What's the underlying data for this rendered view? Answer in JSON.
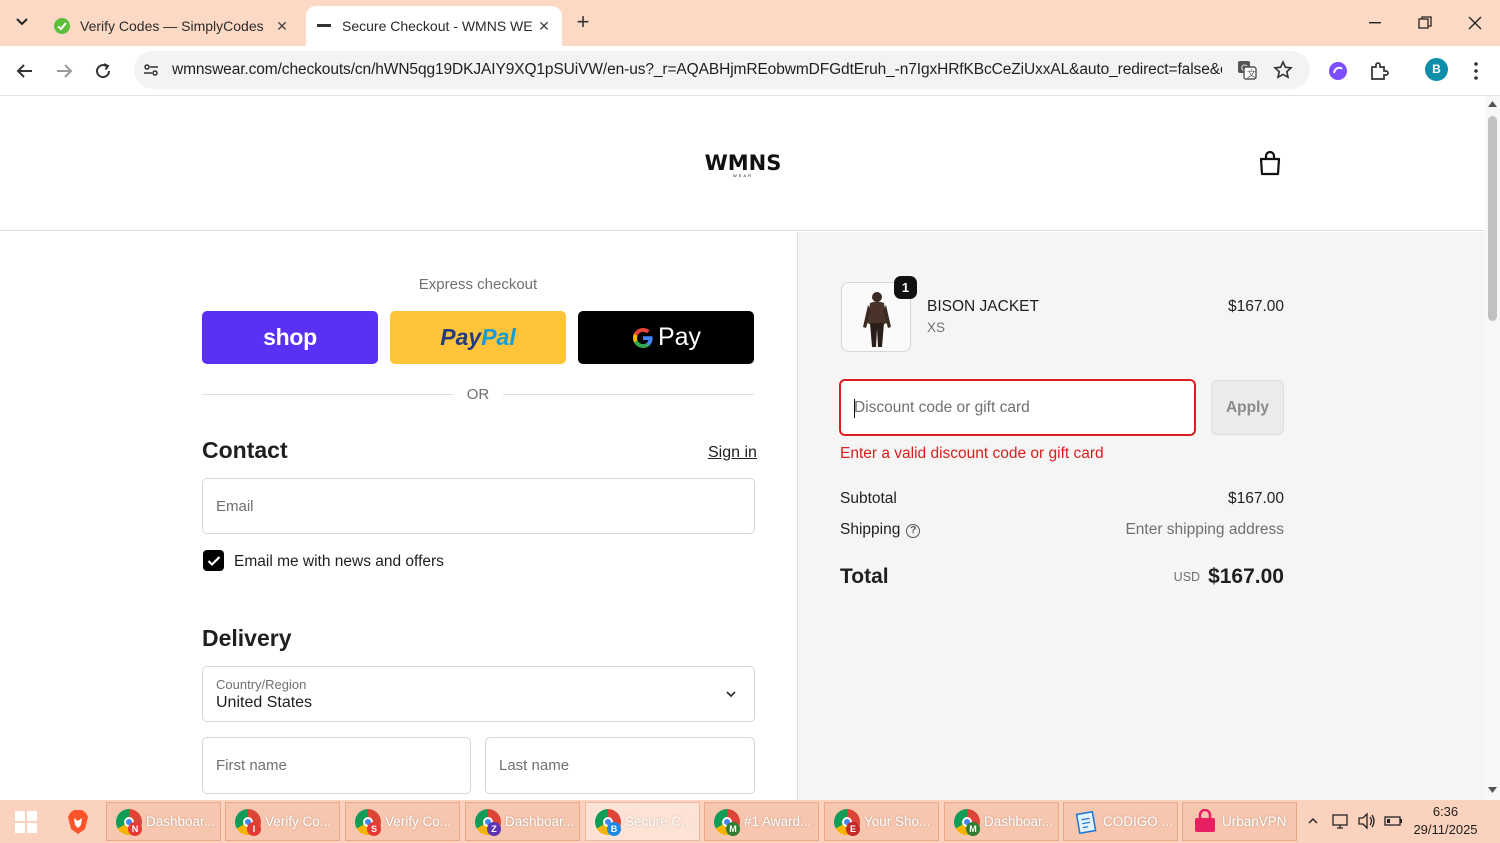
{
  "browser": {
    "tabs": [
      {
        "title": "Verify Codes — SimplyCodes",
        "active": false
      },
      {
        "title": "Secure Checkout - WMNS WEA",
        "active": true
      }
    ],
    "url": "wmnswear.com/checkouts/cn/hWN5qg19DKJAIY9XQ1pSUiVW/en-us?_r=AQABHjmREobwmDFGdtEruh_-n7IgxHRfKBcCeZiUxxAL&auto_redirect=false&e...",
    "profile_initial": "B"
  },
  "store": {
    "logo": "WMNS",
    "logo_sub": "WEAR"
  },
  "express": {
    "label": "Express checkout",
    "shop_label": "shop",
    "paypal_label_a": "Pay",
    "paypal_label_b": "Pal",
    "gpay_label": "Pay",
    "or_label": "OR"
  },
  "contact": {
    "title": "Contact",
    "signin": "Sign in",
    "email_placeholder": "Email",
    "newsletter_label": "Email me with news and offers",
    "newsletter_checked": true
  },
  "delivery": {
    "title": "Delivery",
    "country_label": "Country/Region",
    "country_value": "United States",
    "first_name_placeholder": "First name",
    "last_name_placeholder": "Last name"
  },
  "summary": {
    "product": {
      "name": "BISON JACKET",
      "variant": "XS",
      "price": "$167.00",
      "quantity": "1"
    },
    "discount_placeholder": "Discount code or gift card",
    "apply_label": "Apply",
    "discount_error": "Enter a valid discount code or gift card",
    "subtotal_label": "Subtotal",
    "subtotal_value": "$167.00",
    "shipping_label": "Shipping",
    "shipping_value": "Enter shipping address",
    "total_label": "Total",
    "total_currency": "USD",
    "total_value": "$167.00"
  },
  "taskbar": {
    "items": [
      {
        "label": "Dashboar...",
        "badge": "N",
        "badge_color": "#e53935"
      },
      {
        "label": "Verify Co...",
        "badge": "I",
        "badge_color": "#e53935"
      },
      {
        "label": "Verify Co...",
        "badge": "S",
        "badge_color": "#e53935"
      },
      {
        "label": "Dashboar...",
        "badge": "Z",
        "badge_color": "#5e35b1"
      },
      {
        "label": "Secure C...",
        "badge": "B",
        "badge_color": "#1e88e5"
      },
      {
        "label": "#1 Award...",
        "badge": "M",
        "badge_color": "#2e7d32"
      },
      {
        "label": "Your Sho...",
        "badge": "E",
        "badge_color": "#c62828"
      },
      {
        "label": "Dashboar...",
        "badge": "M",
        "badge_color": "#2e7d32"
      },
      {
        "label": "CODIGO ...",
        "badge": "",
        "badge_color": ""
      },
      {
        "label": "UrbanVPN",
        "badge": "",
        "badge_color": ""
      }
    ],
    "time": "6:36",
    "date": "29/11/2025"
  },
  "colors": {
    "tabbar": "#fcd9c4",
    "shop_purple": "#5a31f4",
    "paypal_yellow": "#ffc439",
    "error_red": "#dd1d1d"
  }
}
